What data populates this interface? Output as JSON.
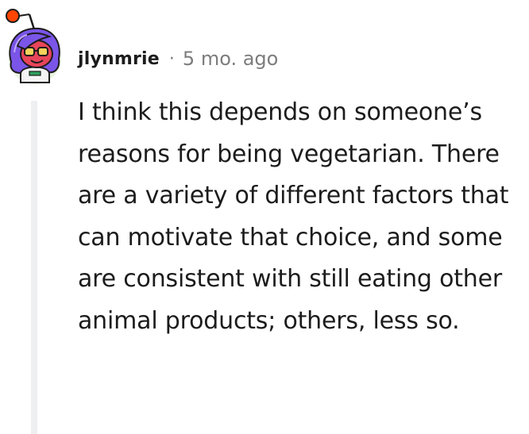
{
  "comment": {
    "avatar_icon": "snoo-avatar-icon",
    "username": "jlynmrie",
    "separator": "·",
    "age": "5 mo. ago",
    "body": "I think this depends on someone’s reasons for being vegetarian. There are a variety of different factors that can motivate that choice, and some are consistent with still eating other animal products; others, less so."
  },
  "colors": {
    "text": "#1c1c1c",
    "meta": "#7c7c7c",
    "thread_line": "#edeff1",
    "avatar_antenna": "#ff4500",
    "avatar_hair": "#7a55e8",
    "avatar_face": "#e8455a",
    "avatar_bg": "#e9f3e0"
  }
}
